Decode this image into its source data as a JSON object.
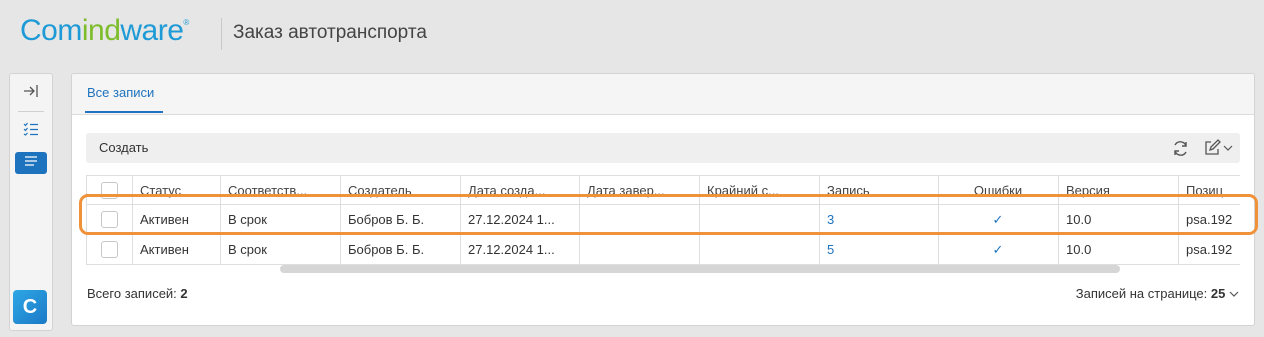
{
  "header": {
    "logo": {
      "part1": "Com",
      "part2": "ind",
      "part3": "ware",
      "reg": "®"
    },
    "app_title": "Заказ автотранспорта"
  },
  "sidebar": {
    "items": [
      {
        "name": "collapse-sidebar",
        "icon": "arrow-to-right-icon"
      },
      {
        "name": "tasks",
        "icon": "checklist-icon"
      },
      {
        "name": "records",
        "icon": "list-icon",
        "active": true
      }
    ],
    "brand_letter": "C"
  },
  "tabs": [
    {
      "label": "Все записи",
      "active": true
    }
  ],
  "toolbar": {
    "create_label": "Создать",
    "icons": [
      "refresh-icon",
      "edit-columns-icon",
      "chevron-down-icon"
    ]
  },
  "table": {
    "columns": [
      "Статус",
      "Соответств...",
      "Создатель",
      "Дата созда...",
      "Дата завер...",
      "Крайний с...",
      "Запись",
      "Ошибки",
      "Версия",
      "Позиц"
    ],
    "rows": [
      {
        "status": "Активен",
        "compliance": "В срок",
        "creator": "Бобров Б. Б.",
        "created": "27.12.2024 1...",
        "completed": "",
        "deadline": "",
        "record": "3",
        "errors": "✓",
        "version": "10.0",
        "position": "psa.192"
      },
      {
        "status": "Активен",
        "compliance": "В срок",
        "creator": "Бобров Б. Б.",
        "created": "27.12.2024 1...",
        "completed": "",
        "deadline": "",
        "record": "5",
        "errors": "✓",
        "version": "10.0",
        "position": "psa.192"
      }
    ]
  },
  "footer": {
    "total_label": "Всего записей:",
    "total_value": "2",
    "per_page_label": "Записей на странице:",
    "per_page_value": "25"
  },
  "colors": {
    "accent": "#1e73be",
    "highlight": "#f0923a",
    "logo_blue": "#1e9ad6",
    "logo_green": "#7dbd2c"
  }
}
